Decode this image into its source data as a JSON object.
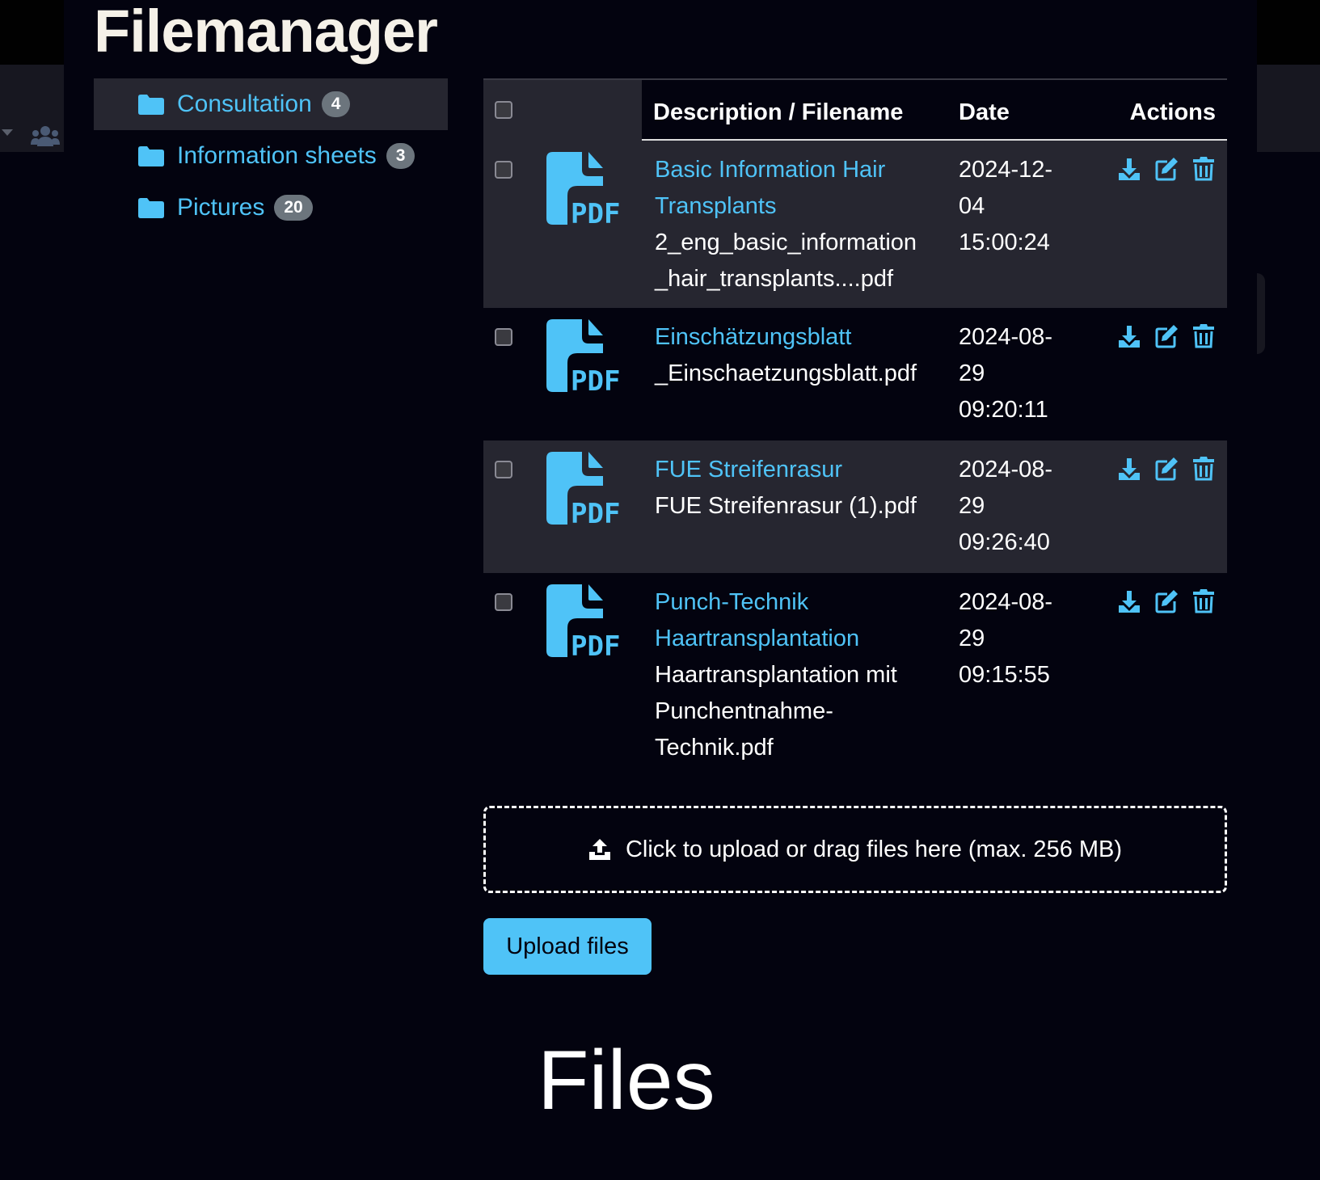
{
  "app": {
    "title": "Filemanager",
    "footer_label": "Files"
  },
  "colors": {
    "accent": "#4fc3f7",
    "background": "#03030f",
    "row_alt": "#262630",
    "badge": "#6c757d"
  },
  "folders": [
    {
      "name": "Consultation",
      "count": "4",
      "active": true,
      "icon": "folder-icon"
    },
    {
      "name": "Information sheets",
      "count": "3",
      "active": false,
      "icon": "folder-icon"
    },
    {
      "name": "Pictures",
      "count": "20",
      "active": false,
      "icon": "folder-icon"
    }
  ],
  "table": {
    "headers": {
      "description": "Description / Filename",
      "date": "Date",
      "actions": "Actions"
    },
    "rows": [
      {
        "title_lines": [
          "Basic Information Hair",
          "Transplants"
        ],
        "filename_lines": [
          "2_eng_basic_information",
          "_hair_transplants....pdf"
        ],
        "date_lines": [
          "2024-12-",
          "04",
          "15:00:24"
        ]
      },
      {
        "title_lines": [
          "Einschätzungsblatt"
        ],
        "filename_lines": [
          "_Einschaetzungsblatt.pdf"
        ],
        "date_lines": [
          "2024-08-",
          "29",
          "09:20:11"
        ]
      },
      {
        "title_lines": [
          "FUE Streifenrasur"
        ],
        "filename_lines": [
          "FUE Streifenrasur (1).pdf"
        ],
        "date_lines": [
          "2024-08-",
          "29",
          "09:26:40"
        ]
      },
      {
        "title_lines": [
          "Punch-Technik",
          "Haartransplantation"
        ],
        "filename_lines": [
          "Haartransplantation mit",
          "Punchentnahme-",
          "Technik.pdf"
        ],
        "date_lines": [
          "2024-08-",
          "29",
          "09:15:55"
        ]
      }
    ],
    "file_icon": "pdf-file-icon",
    "action_icons": [
      "download-icon",
      "edit-icon",
      "trash-icon"
    ]
  },
  "upload": {
    "dropzone_text": "Click to upload or drag files here (max. 256 MB)",
    "button_label": "Upload files"
  }
}
